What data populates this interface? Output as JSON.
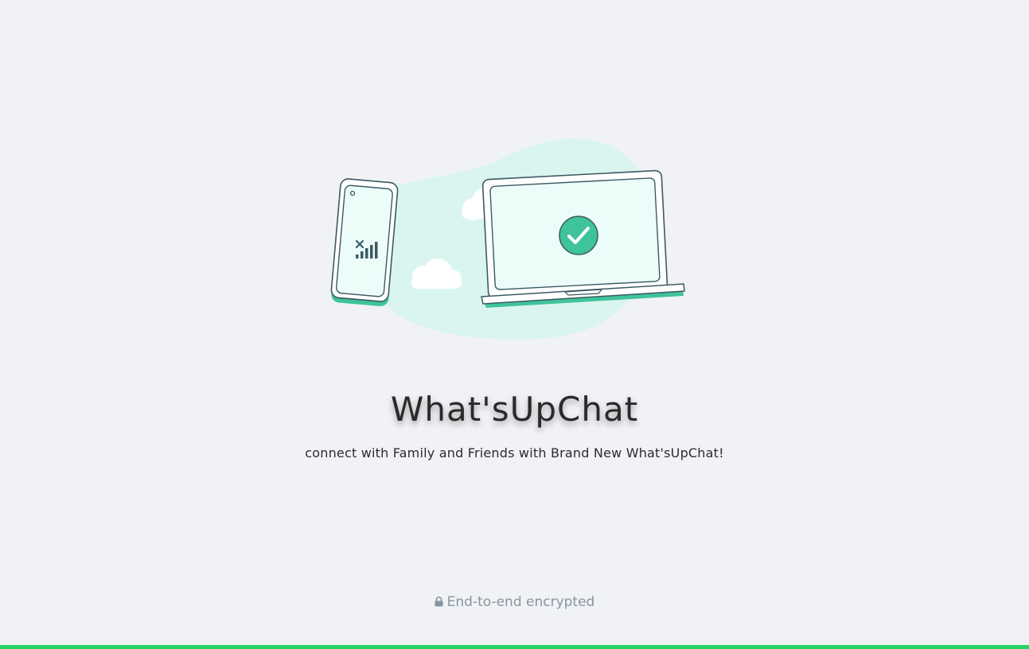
{
  "app": {
    "title": "What'sUpChat",
    "subtitle": "connect with Family and Friends with Brand New What'sUpChat!"
  },
  "footer": {
    "encryption_text": "End-to-end encrypted",
    "lock_icon": "lock-icon"
  },
  "illustration": {
    "phone_icon": "phone-no-signal-icon",
    "laptop_icon": "laptop-check-icon",
    "cloud_icon": "cloud-icon"
  },
  "colors": {
    "background": "#f0f2f5",
    "accent": "#25d366",
    "teal": "#3fc39b",
    "blob": "#daf5f0",
    "outline": "#3b5a63",
    "screen": "#ecfcf9",
    "muted_text": "#8696a0"
  }
}
